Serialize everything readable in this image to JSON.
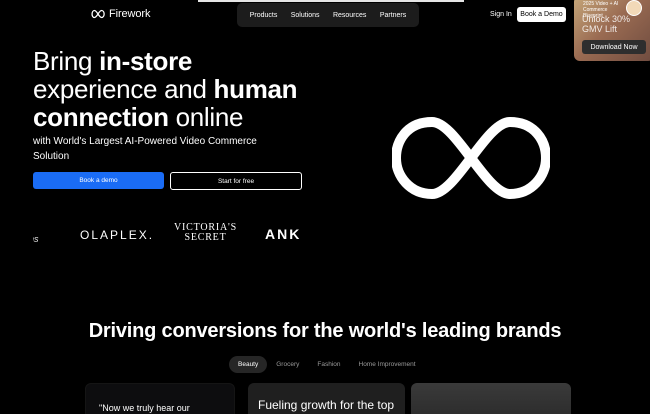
{
  "brand": {
    "name": "Firework"
  },
  "nav": {
    "items": [
      "Products",
      "Solutions",
      "Resources",
      "Partners"
    ]
  },
  "header": {
    "signin": "Sign In",
    "book_demo": "Book a Demo"
  },
  "promo": {
    "small": "2025 Video + AI Commerce Blueprint",
    "big": "Unlock 30% GMV Lift",
    "button": "Download Now"
  },
  "hero": {
    "headline_1": "Bring ",
    "headline_1b": "in-store",
    "headline_2": "experience and ",
    "headline_2b": "human",
    "headline_3b": "connection",
    "headline_3": " online",
    "subhead": "with World's Largest AI-Powered Video Commerce Solution",
    "cta_primary": "Book a demo",
    "cta_secondary": "Start for free"
  },
  "logos": {
    "partial": "ns",
    "olaplex": "OLAPLEX.",
    "victorias_1": "VICTORIA'S",
    "victorias_2": "SECRET",
    "anker": "ANK"
  },
  "section": {
    "title": "Driving conversions for the world's leading brands",
    "tabs": [
      "Beauty",
      "Grocery",
      "Fashion",
      "Home Improvement"
    ],
    "active_tab": "Beauty"
  },
  "cards": {
    "card1_text": "\"Now we truly hear our",
    "card2_text": "Fueling growth for the top"
  }
}
